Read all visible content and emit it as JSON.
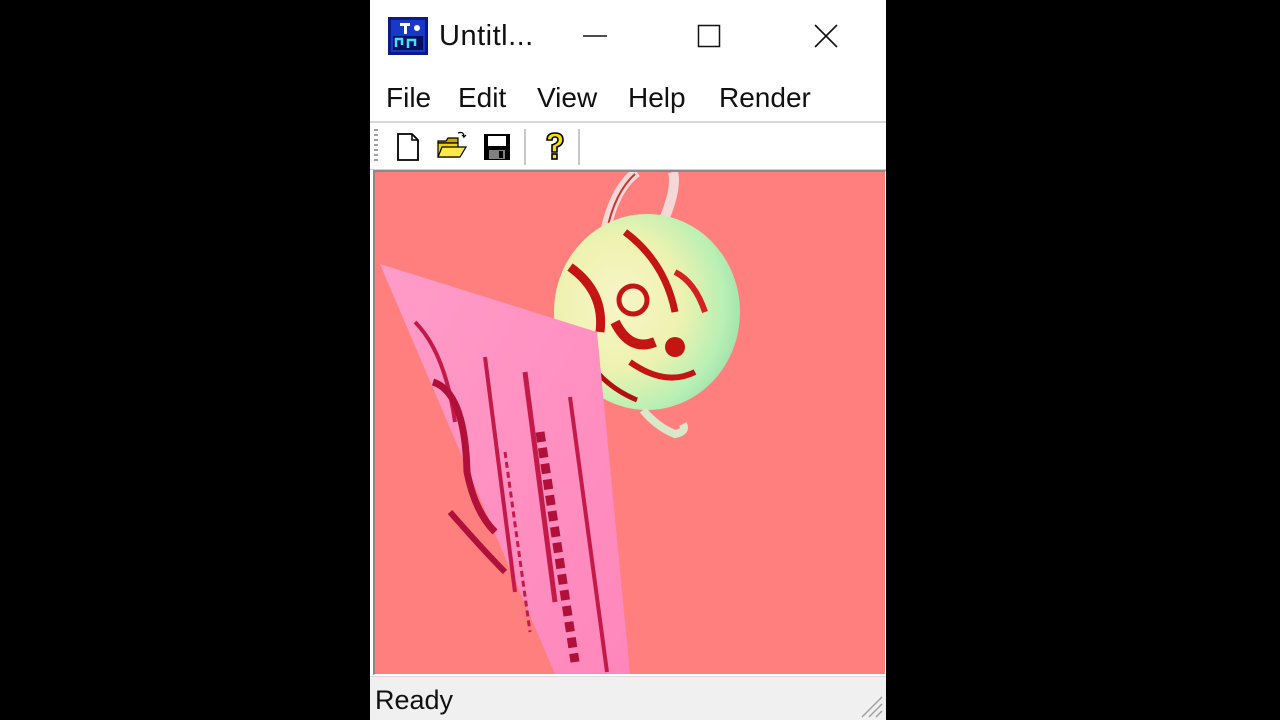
{
  "window": {
    "title": "Untitl..."
  },
  "menu": {
    "items": [
      "File",
      "Edit",
      "View",
      "Help",
      "Render"
    ]
  },
  "toolbar": {
    "buttons": [
      "new-file",
      "open-folder",
      "save-disk",
      "help-question"
    ]
  },
  "viewport": {
    "background": "#ff7f7f",
    "plane_color": "#ff8fbf",
    "sphere_colors": [
      "#e9f5b8",
      "#a8f0b0",
      "#cc1a1a"
    ]
  },
  "status": {
    "text": "Ready"
  }
}
